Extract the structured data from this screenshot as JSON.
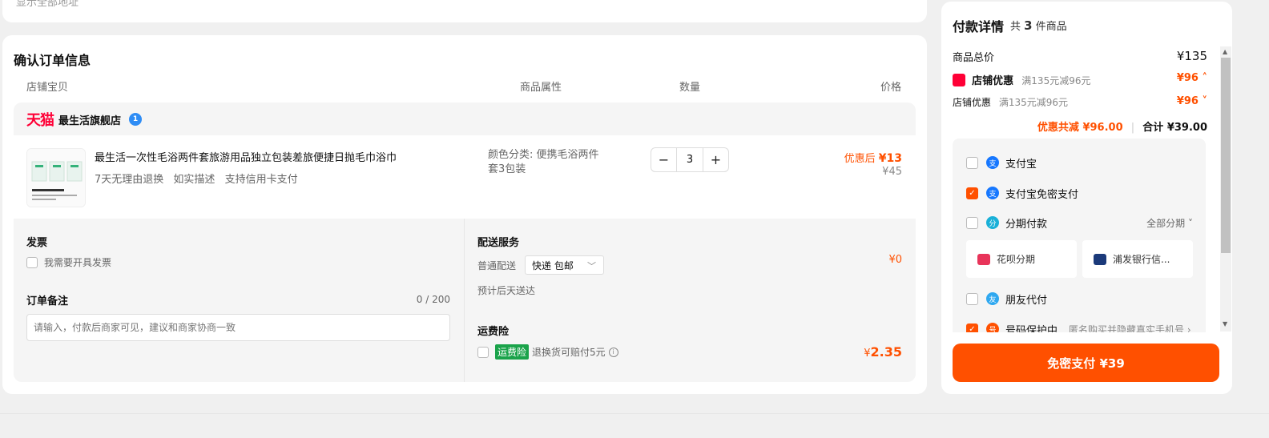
{
  "address": {
    "show_all": "显示全部地址 ˅"
  },
  "order": {
    "title": "确认订单信息",
    "columns": {
      "store_item": "店铺宝贝",
      "attributes": "商品属性",
      "quantity": "数量",
      "price": "价格"
    },
    "store": {
      "platform": "天猫",
      "name": "最生活旗舰店",
      "badge": "1"
    },
    "item": {
      "title": "最生活一次性毛浴两件套旅游用品独立包装差旅便捷日抛毛巾浴巾",
      "tags": [
        "7天无理由退换",
        "如实描述",
        "支持信用卡支付"
      ],
      "attribute": "颜色分类: 便携毛浴两件套3包装",
      "qty_minus": "−",
      "qty": "3",
      "qty_plus": "+",
      "price_after_label": "优惠后",
      "price_after": "¥13",
      "price_orig": "¥45"
    },
    "invoice": {
      "title": "发票",
      "option": "我需要开具发票"
    },
    "memo": {
      "title": "订单备注",
      "count": "0 / 200",
      "placeholder": "请输入，付款后商家可见，建议和商家协商一致"
    },
    "shipping": {
      "title": "配送服务",
      "label": "普通配送",
      "selected": "快递 包邮",
      "fee": "¥0",
      "eta": "预计后天送达"
    },
    "insurance": {
      "title": "运费险",
      "tag": "运费险",
      "text": "退换货可赔付5元",
      "fee_symbol": "¥",
      "fee": "2.35"
    }
  },
  "payment": {
    "title": "付款详情",
    "count_prefix": "共",
    "count": "3",
    "count_suffix": "件商品",
    "total_label": "商品总价",
    "total": "¥135",
    "shop_discount_label": "店铺优惠",
    "shop_discount_rule": "满135元减96元",
    "shop_discount": "¥96 ˄",
    "shop_discount2_label": "店铺优惠",
    "shop_discount2_rule": "满135元减96元",
    "shop_discount2": "¥96 ˅",
    "saved": "优惠共减 ¥96.00",
    "sum": "合计 ¥39.00",
    "methods": {
      "alipay": "支付宝",
      "alipay_nopwd": "支付宝免密支付",
      "installment": "分期付款",
      "installment_all": "全部分期 ˅",
      "huabei": "花呗分期",
      "spdb": "浦发银行信...",
      "friend": "朋友代付",
      "privacy": "号码保护中",
      "privacy_desc": "匿名购买并隐藏真实手机号 ›"
    },
    "button": "免密支付 ¥39"
  }
}
